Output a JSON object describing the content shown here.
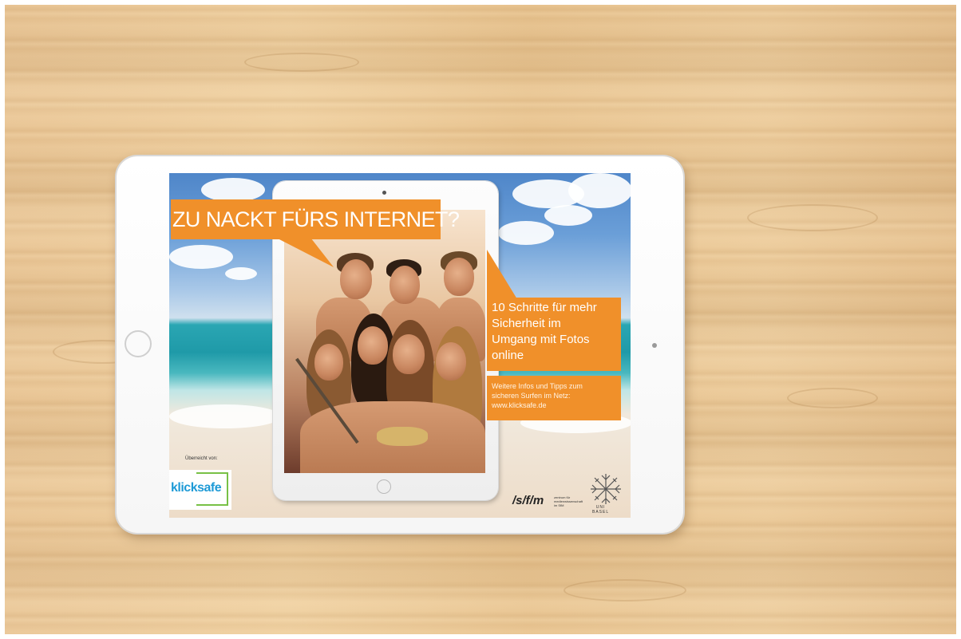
{
  "poster": {
    "headline": "ZU NACKT FÜRS INTERNET?",
    "info_lines": [
      "10 Schritte für mehr",
      "Sicherheit im",
      "Umgang mit Fotos",
      "online"
    ],
    "tips_lines": [
      "Weitere Infos und Tipps zum",
      "sicheren Surfen im Netz:",
      "www.klicksafe.de"
    ],
    "supported_by": "Überreicht von:",
    "klicksafe_logo": "klicksafe",
    "sfm_logo": "/s/f/m",
    "sfm_subtitle": [
      "zentrum für",
      "medienwissenschaft",
      "im SfM"
    ],
    "uni_logo_text": [
      "UNI",
      "BASEL"
    ]
  },
  "colors": {
    "accent_orange": "#f0902a",
    "klicksafe_blue": "#1d9ad6",
    "klicksafe_green": "#78c046"
  }
}
